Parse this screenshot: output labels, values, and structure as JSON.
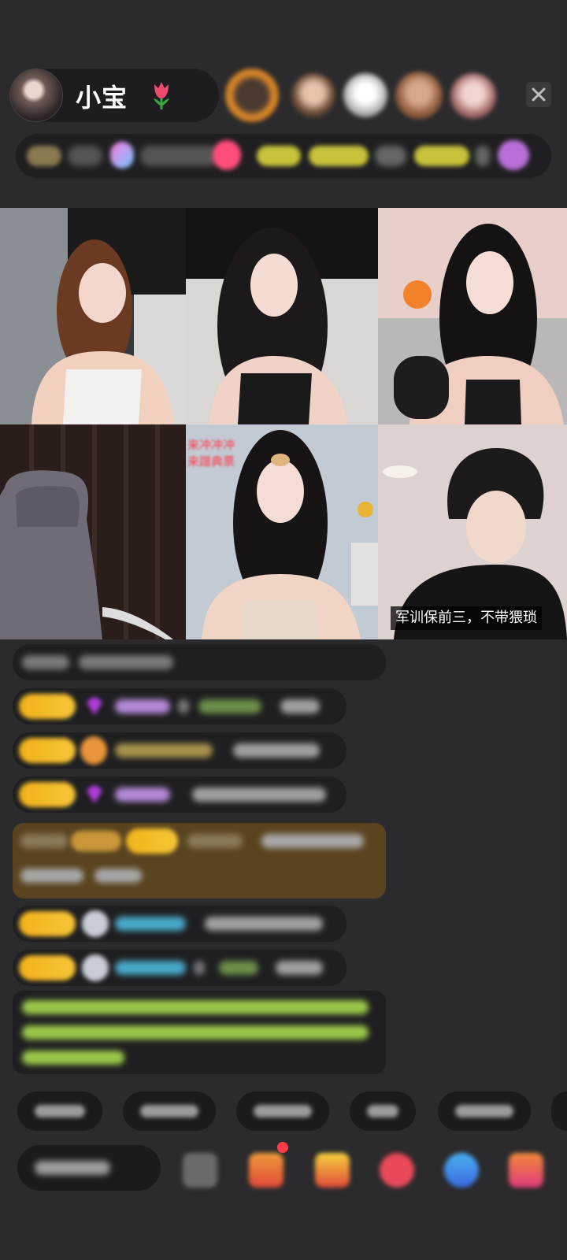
{
  "header": {
    "host_name": "小宝",
    "host_avatar_icon": "host-avatar",
    "name_emoji_icon": "tulip-icon",
    "close_icon": "close-icon",
    "viewer_avatars": [
      "viewer-avatar-1",
      "viewer-avatar-2",
      "viewer-avatar-3",
      "viewer-avatar-4",
      "viewer-avatar-5"
    ]
  },
  "video_grid": {
    "cells": [
      {
        "name": "video-seat-1"
      },
      {
        "name": "video-seat-2"
      },
      {
        "name": "video-seat-3"
      },
      {
        "name": "video-seat-4"
      },
      {
        "name": "video-seat-5"
      },
      {
        "name": "video-seat-6"
      }
    ],
    "seat5_overlay_lines": [
      "来冲冲冲",
      "来蹭典票"
    ],
    "seat6_subtitle": "军训保前三，不带猥琐"
  },
  "chat": {
    "messages_count_visible": 9
  },
  "quick_replies": [
    "q1",
    "q2",
    "q3",
    "q4",
    "q5",
    "q6"
  ],
  "bottom_bar": {
    "icons": [
      "grid-icon",
      "gift-box-icon",
      "treasure-icon",
      "chat-bubble-icon",
      "game-icon",
      "more-icon"
    ]
  },
  "colors": {
    "background": "#2b2b2d",
    "badge_gold": "#f2b21b",
    "gift_row_brown": "#5a4420",
    "green_text": "#9cc94a",
    "blue_text": "#4aa8c8",
    "purple_name": "#b58ad8",
    "red_accent": "#ff3b4a"
  }
}
